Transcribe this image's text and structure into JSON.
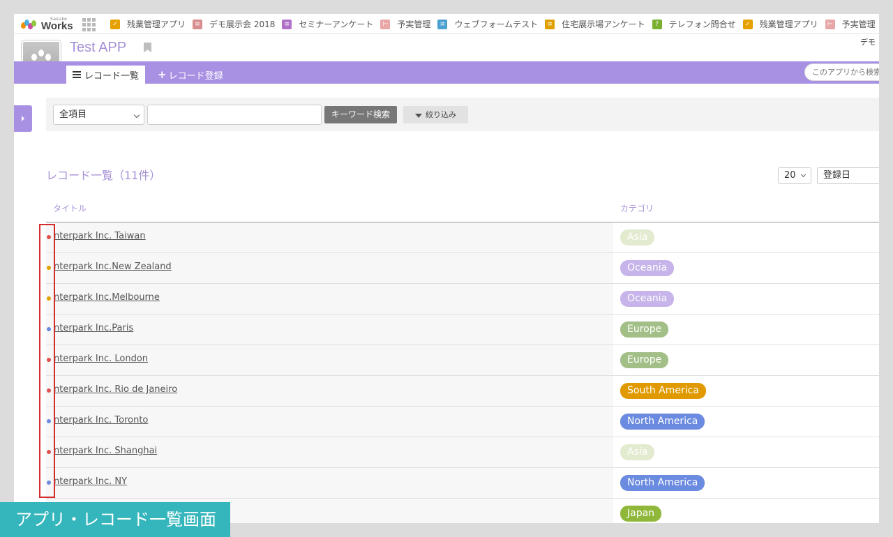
{
  "topbar": {
    "logo_sub": "Sasuke",
    "logo_word": "Works",
    "apps": [
      {
        "label": "残業管理アプリ",
        "color": "#e6a100",
        "glyph": "✓"
      },
      {
        "label": "デモ展示会 2018",
        "color": "#d88f8f",
        "glyph": "≡"
      },
      {
        "label": "セミナーアンケート",
        "color": "#b070c8",
        "glyph": "≡"
      },
      {
        "label": "予実管理",
        "color": "#e8a6a6",
        "glyph": "⊢"
      },
      {
        "label": "ウェブフォームテスト",
        "color": "#4aa0d0",
        "glyph": "≡"
      },
      {
        "label": "住宅展示場アンケート",
        "color": "#e0a000",
        "glyph": "≡"
      },
      {
        "label": "テレフォン問合せ",
        "color": "#7ab030",
        "glyph": "?"
      },
      {
        "label": "残業管理アプリ",
        "color": "#e6a100",
        "glyph": "✓"
      },
      {
        "label": "予実管理",
        "color": "#e8a6a6",
        "glyph": "⊢"
      }
    ]
  },
  "header": {
    "app_title": "Test APP",
    "user_name": "デモ"
  },
  "tabs": {
    "list_label": "レコード一覧",
    "add_label": "レコード登録",
    "search_placeholder": "このアプリから検索"
  },
  "filter": {
    "field_select": "全項目",
    "keyword_value": "",
    "keyword_button": "キーワード検索",
    "filter_button": "絞り込み"
  },
  "list": {
    "title": "レコード一覧（11件）",
    "per_page": "20",
    "sort": "登録日",
    "col_title": "タイトル",
    "col_category": "カテゴリ"
  },
  "rows": [
    {
      "title": "nterpark Inc. Taiwan",
      "category": "Asia",
      "dot": "#e05050",
      "badge": "#e2ebcf"
    },
    {
      "title": "nterpark Inc.New Zealand",
      "category": "Oceania",
      "dot": "#e0a000",
      "badge": "#c6b4ea"
    },
    {
      "title": "nterpark Inc.Melbourne",
      "category": "Oceania",
      "dot": "#e0a000",
      "badge": "#c6b4ea"
    },
    {
      "title": "nterpark Inc.Paris",
      "category": "Europe",
      "dot": "#6b8be0",
      "badge": "#a3bf88"
    },
    {
      "title": "nterpark Inc. London",
      "category": "Europe",
      "dot": "#e05050",
      "badge": "#a3bf88"
    },
    {
      "title": "nterpark Inc. Rio de Janeiro",
      "category": "South America",
      "dot": "#e05050",
      "badge": "#e09a00"
    },
    {
      "title": "nterpark Inc. Toronto",
      "category": "North America",
      "dot": "#6b8be0",
      "badge": "#6b8be0"
    },
    {
      "title": "nterpark Inc. Shanghai",
      "category": "Asia",
      "dot": "#e05050",
      "badge": "#e2ebcf"
    },
    {
      "title": "nterpark Inc. NY",
      "category": "North America",
      "dot": "#6b8be0",
      "badge": "#6b8be0"
    },
    {
      "title": "",
      "category": "Japan",
      "dot": "",
      "badge": "#8fb83a"
    }
  ],
  "caption": "アプリ・レコード一覧画面"
}
